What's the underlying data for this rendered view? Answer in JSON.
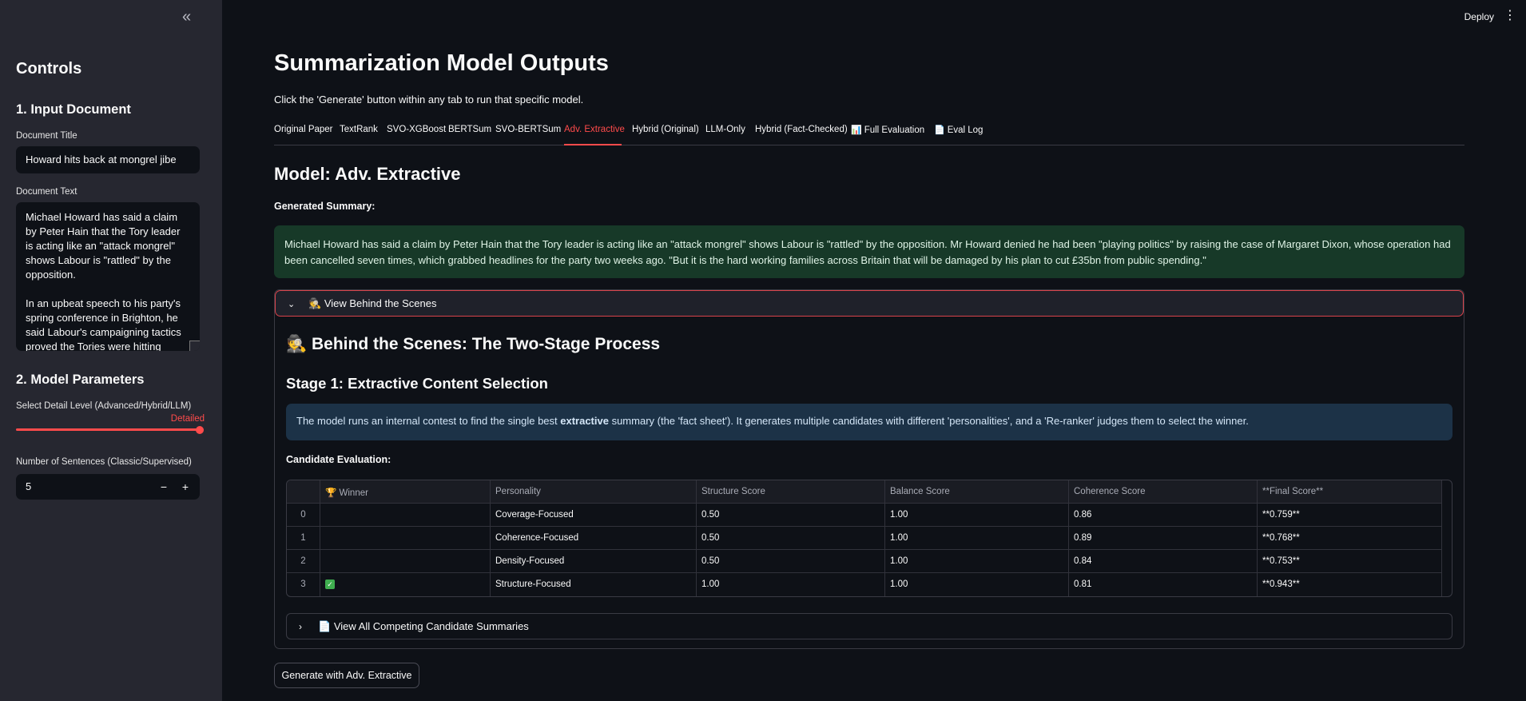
{
  "sidebar": {
    "collapse_icon": "«",
    "heading": "Controls",
    "section1": "1. Input Document",
    "doc_title_label": "Document Title",
    "doc_title_value": "Howard hits back at mongrel jibe",
    "doc_text_label": "Document Text",
    "doc_text_p1": "Michael Howard has said a claim by Peter Hain that the Tory leader is acting like an \"attack mongrel\" shows Labour is \"rattled\" by the opposition.",
    "doc_text_p2": "In an upbeat speech to his party's spring conference in Brighton, he said Labour's campaigning tactics proved the Tories were hitting",
    "section2": "2. Model Parameters",
    "detail_label": "Select Detail Level (Advanced/Hybrid/LLM)",
    "detail_value": "Detailed",
    "detail_level": 1.0,
    "sentences_label": "Number of Sentences (Classic/Supervised)",
    "sentences_value": "5",
    "minus": "−",
    "plus": "+"
  },
  "header": {
    "deploy": "Deploy",
    "menu_icon": "⋮"
  },
  "main": {
    "title": "Summarization Model Outputs",
    "subtitle": "Click the 'Generate' button within any tab to run that specific model.",
    "tabs": [
      {
        "label": "Original Paper",
        "icon": ""
      },
      {
        "label": "TextRank",
        "icon": ""
      },
      {
        "label": "SVO-XGBoost",
        "icon": ""
      },
      {
        "label": "BERTSum",
        "icon": ""
      },
      {
        "label": "SVO-BERTSum",
        "icon": ""
      },
      {
        "label": "Adv. Extractive",
        "icon": ""
      },
      {
        "label": "Hybrid (Original)",
        "icon": ""
      },
      {
        "label": "LLM-Only",
        "icon": ""
      },
      {
        "label": "Hybrid (Fact-Checked)",
        "icon": ""
      },
      {
        "label": "Full Evaluation",
        "icon": "📊"
      },
      {
        "label": "Eval Log",
        "icon": "📄"
      }
    ],
    "active_tab": "Adv. Extractive",
    "model_heading": "Model: Adv. Extractive",
    "generated_label": "Generated Summary:",
    "summary": "Michael Howard has said a claim by Peter Hain that the Tory leader is acting like an \"attack mongrel\" shows Labour is \"rattled\" by the opposition. Mr Howard denied he had been \"playing politics\" by raising the case of Margaret Dixon, whose operation had been cancelled seven times, which grabbed headlines for the party two weeks ago. \"But it is the hard working families across Britain that will be damaged by his plan to cut £35bn from public spending.\"",
    "expander": {
      "label": "View Behind the Scenes",
      "icon": "🕵️",
      "h1": "Behind the Scenes: The Two-Stage Process",
      "h1_icon": "🕵️",
      "h2": "Stage 1: Extractive Content Selection",
      "info_pre": "The model runs an internal contest to find the single best ",
      "info_bold": "extractive",
      "info_post": " summary (the 'fact sheet'). It generates multiple candidates with different 'personalities', and a 'Re-ranker' judges them to select the winner.",
      "candidate_label": "Candidate Evaluation:",
      "table": {
        "headers": [
          "",
          "🏆 Winner",
          "Personality",
          "Structure Score",
          "Balance Score",
          "Coherence Score",
          "**Final Score**"
        ],
        "rows": [
          {
            "idx": "0",
            "winner": false,
            "personality": "Coverage-Focused",
            "structure": "0.50",
            "balance": "1.00",
            "coherence": "0.86",
            "final": "**0.759**"
          },
          {
            "idx": "1",
            "winner": false,
            "personality": "Coherence-Focused",
            "structure": "0.50",
            "balance": "1.00",
            "coherence": "0.89",
            "final": "**0.768**"
          },
          {
            "idx": "2",
            "winner": false,
            "personality": "Density-Focused",
            "structure": "0.50",
            "balance": "1.00",
            "coherence": "0.84",
            "final": "**0.753**"
          },
          {
            "idx": "3",
            "winner": true,
            "personality": "Structure-Focused",
            "structure": "1.00",
            "balance": "1.00",
            "coherence": "0.81",
            "final": "**0.943**"
          }
        ]
      },
      "inner_label": "View All Competing Candidate Summaries",
      "inner_icon": "📄"
    },
    "generate_button": "Generate with Adv. Extractive"
  }
}
